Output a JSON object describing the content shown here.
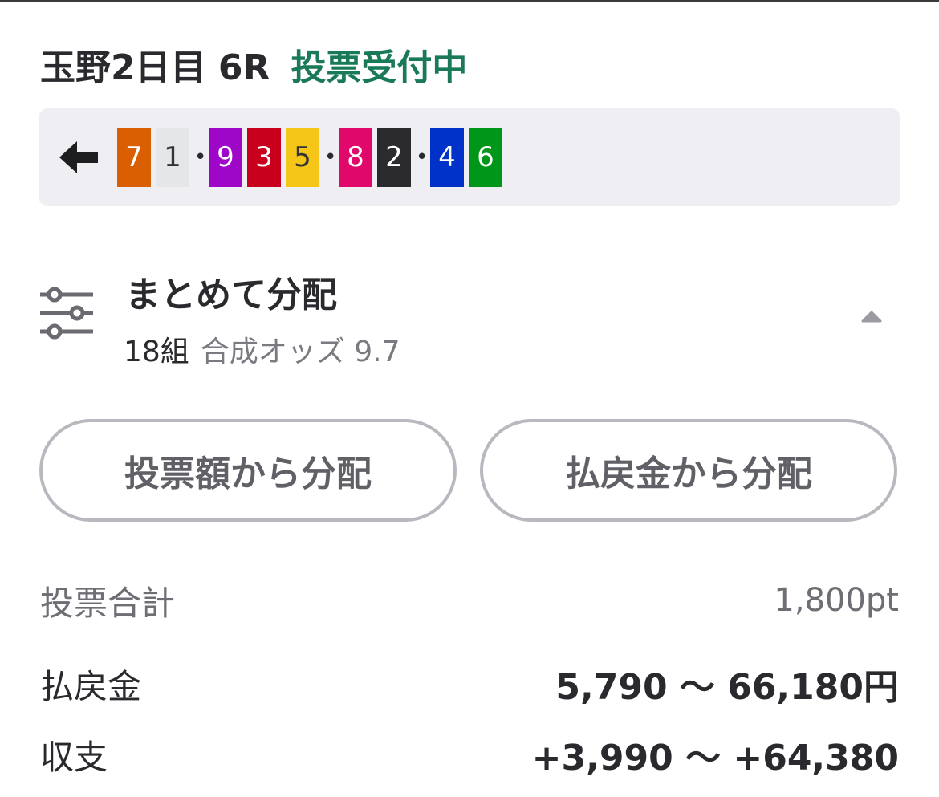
{
  "header": {
    "race_title": "玉野2日目 6R",
    "status": "投票受付中",
    "status_color": "#1a7a58"
  },
  "sequence": {
    "back_icon": "arrow-left-icon",
    "groups": [
      [
        {
          "num": "7",
          "color": "#d95f02"
        },
        {
          "num": "1",
          "color": "#e4e6e8"
        }
      ],
      [
        {
          "num": "9",
          "color": "#9e07c8"
        },
        {
          "num": "3",
          "color": "#c8001e"
        },
        {
          "num": "5",
          "color": "#f5c518"
        }
      ],
      [
        {
          "num": "8",
          "color": "#e0086b"
        },
        {
          "num": "2",
          "color": "#2b2b2e"
        }
      ],
      [
        {
          "num": "4",
          "color": "#0031c8"
        },
        {
          "num": "6",
          "color": "#009718"
        }
      ]
    ],
    "separator": "•"
  },
  "distribution": {
    "icon": "sliders-icon",
    "title": "まとめて分配",
    "count": "18組",
    "odds": "合成オッズ 9.7",
    "toggle_icon": "chevron-up-icon"
  },
  "buttons": {
    "by_bet": "投票額から分配",
    "by_payout": "払戻金から分配"
  },
  "summary": {
    "total_label": "投票合計",
    "total_value": "1,800pt",
    "payout_label": "払戻金",
    "payout_value": "5,790 〜 66,180円",
    "balance_label": "収支",
    "balance_value": "+3,990 〜 +64,380"
  }
}
